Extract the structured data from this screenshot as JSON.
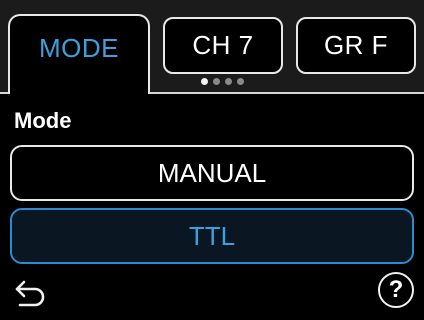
{
  "tabs": [
    {
      "label": "MODE",
      "active": true
    },
    {
      "label": "CH 7",
      "active": false
    },
    {
      "label": "GR F",
      "active": false
    }
  ],
  "pagination": {
    "pages": 4,
    "current": 1
  },
  "section": {
    "title": "Mode"
  },
  "options": [
    {
      "label": "MANUAL",
      "selected": false
    },
    {
      "label": "TTL",
      "selected": true
    }
  ],
  "footer": {
    "back_icon": "back-arrow-icon",
    "help_label": "?"
  },
  "colors": {
    "accent": "#3aa0e0",
    "selected_border": "#2c8bd0",
    "background": "#000000"
  }
}
